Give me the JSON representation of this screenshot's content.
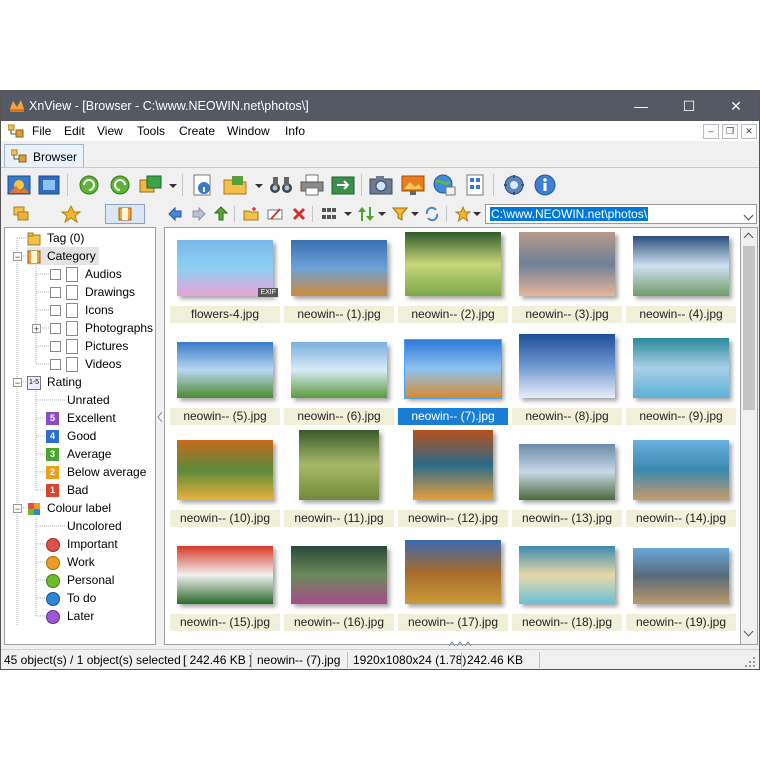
{
  "window": {
    "title": "XnView - [Browser - C:\\www.NEOWIN.net\\photos\\]",
    "title_bar_color": "#545963",
    "controls": {
      "minimize": "—",
      "maximize": "☐",
      "close": "✕"
    }
  },
  "menu": {
    "items": [
      "File",
      "Edit",
      "View",
      "Tools",
      "Create",
      "Window",
      "Info"
    ],
    "mdi": {
      "minimize": "–",
      "restore": "❐",
      "close": "✕"
    }
  },
  "tab": {
    "label": "Browser"
  },
  "address": {
    "value": "C:\\www.NEOWIN.net\\photos\\"
  },
  "tree": {
    "tag": "Tag (0)",
    "category": "Category",
    "categories": [
      "Audios",
      "Drawings",
      "Icons",
      "Photographs",
      "Pictures",
      "Videos"
    ],
    "rating": "Rating",
    "ratings": [
      {
        "label": "Unrated",
        "badge": "",
        "color": ""
      },
      {
        "label": "Excellent",
        "badge": "5",
        "color": "#8a4fc8"
      },
      {
        "label": "Good",
        "badge": "4",
        "color": "#2d6fd0"
      },
      {
        "label": "Average",
        "badge": "3",
        "color": "#4aa52e"
      },
      {
        "label": "Below average",
        "badge": "2",
        "color": "#e8a21a"
      },
      {
        "label": "Bad",
        "badge": "1",
        "color": "#d9452e"
      }
    ],
    "colour_label": "Colour label",
    "colours": [
      {
        "label": "Uncolored",
        "color": ""
      },
      {
        "label": "Important",
        "color": "#e0504a"
      },
      {
        "label": "Work",
        "color": "#f19b22"
      },
      {
        "label": "Personal",
        "color": "#6dbb2a"
      },
      {
        "label": "To do",
        "color": "#2f86d8"
      },
      {
        "label": "Later",
        "color": "#9b58d1"
      }
    ]
  },
  "thumbnails": [
    {
      "name": "flowers-4.jpg",
      "exif": "EXIF"
    },
    {
      "name": "neowin-- (1).jpg"
    },
    {
      "name": "neowin-- (2).jpg"
    },
    {
      "name": "neowin-- (3).jpg"
    },
    {
      "name": "neowin-- (4).jpg"
    },
    {
      "name": "neowin-- (5).jpg"
    },
    {
      "name": "neowin-- (6).jpg"
    },
    {
      "name": "neowin-- (7).jpg",
      "selected": true
    },
    {
      "name": "neowin-- (8).jpg"
    },
    {
      "name": "neowin-- (9).jpg"
    },
    {
      "name": "neowin-- (10).jpg"
    },
    {
      "name": "neowin-- (11).jpg"
    },
    {
      "name": "neowin-- (12).jpg"
    },
    {
      "name": "neowin-- (13).jpg"
    },
    {
      "name": "neowin-- (14).jpg"
    },
    {
      "name": "neowin-- (15).jpg"
    },
    {
      "name": "neowin-- (16).jpg"
    },
    {
      "name": "neowin-- (17).jpg"
    },
    {
      "name": "neowin-- (18).jpg"
    },
    {
      "name": "neowin-- (19).jpg"
    }
  ],
  "status": {
    "count": "45 object(s) / 1 object(s) selected",
    "size_total": "[ 242.46 KB ]",
    "file": "neowin-- (7).jpg",
    "dims": "1920x1080x24 (1.78)",
    "size": "242.46 KB"
  },
  "colors": {
    "selection": "#1a7fd4",
    "caption_bg": "#f0efd8",
    "address_highlight": "#0078d7"
  }
}
